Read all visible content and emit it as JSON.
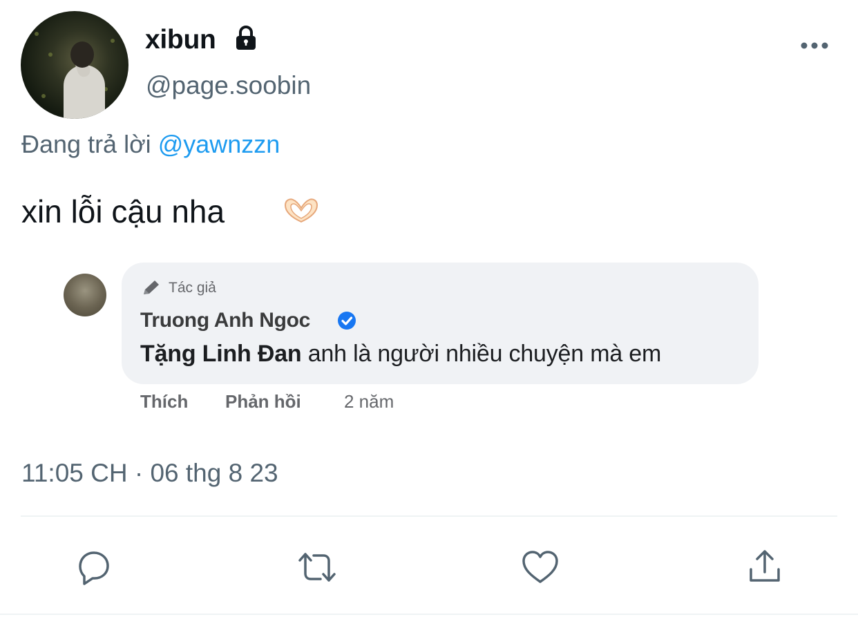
{
  "author": {
    "display_name": "xibun",
    "handle": "@page.soobin",
    "protected_icon": "lock-icon",
    "avatar": "avatar"
  },
  "reply": {
    "prefix": "Đang trả lời",
    "mention": "@yawnzzn"
  },
  "tweet": {
    "text": "xin lỗi cậu nha",
    "emoji": "heart-hands-icon",
    "timestamp": "11:05 CH · 06 thg 8 23"
  },
  "embedded_image": {
    "author_tag": "Tác giả",
    "name": "Truong Anh Ngoc",
    "comment_bold": "Tặng Linh Đan",
    "comment_rest": " anh là người nhiều chuyện mà em",
    "like_label": "Thích",
    "reply_label": "Phản hồi",
    "time": "2 năm"
  },
  "actions": [
    "reply-icon",
    "retweet-icon",
    "like-icon",
    "share-icon"
  ],
  "colors": {
    "accent": "#1d9bf0",
    "secondary_text": "#536471",
    "primary_text": "#0f1419",
    "fb_bubble": "#f0f2f5",
    "fb_verified": "#1877f2"
  }
}
